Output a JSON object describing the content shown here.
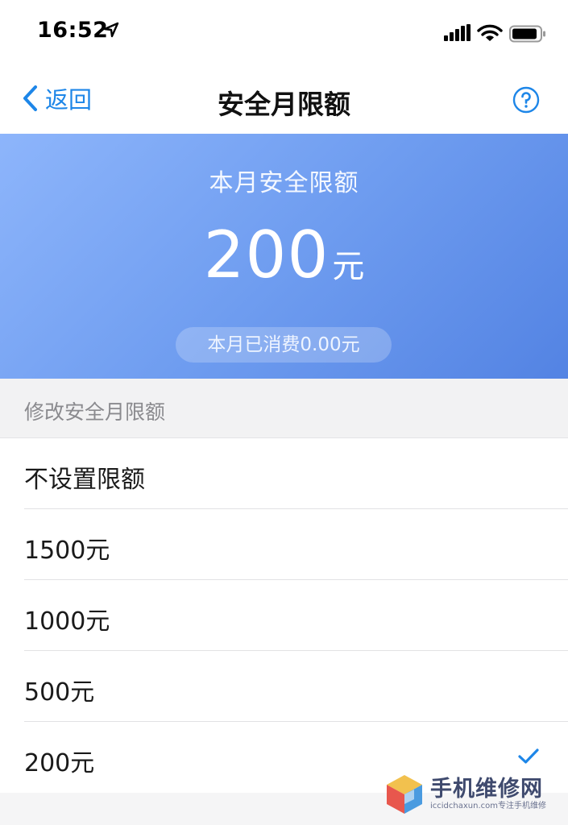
{
  "status_bar": {
    "time": "16:52",
    "icons": [
      "location-arrow-icon",
      "signal-icon",
      "wifi-icon",
      "battery-icon"
    ]
  },
  "nav": {
    "back_label": "返回",
    "title": "安全月限额",
    "help_icon": "question-circle-icon",
    "accent_color": "#1d86e8"
  },
  "hero": {
    "title": "本月安全限额",
    "amount": "200",
    "unit": "元",
    "spent": "本月已消费0.00元",
    "gradient": [
      "#8db5fb",
      "#5383e3"
    ]
  },
  "section": {
    "header": "修改安全月限额"
  },
  "options": [
    {
      "label": "不设置限额",
      "selected": false
    },
    {
      "label": "1500元",
      "selected": false
    },
    {
      "label": "1000元",
      "selected": false
    },
    {
      "label": "500元",
      "selected": false
    },
    {
      "label": "200元",
      "selected": true
    }
  ],
  "watermark": {
    "title": "手机维修网",
    "subtitle": "iccidchaxun.com专注手机维修"
  }
}
